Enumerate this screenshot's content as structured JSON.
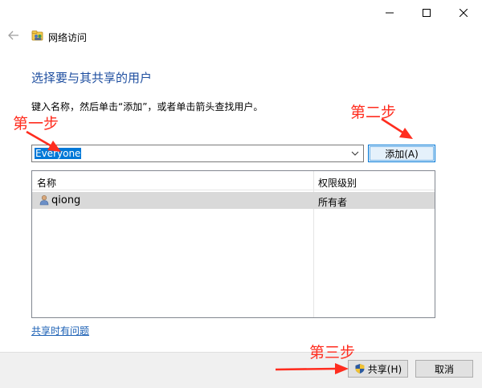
{
  "window": {
    "title": "网络访问",
    "controls": {
      "minimize": "minimize-icon",
      "maximize": "maximize-icon",
      "close": "close-icon"
    }
  },
  "heading": "选择要与其共享的用户",
  "instruction": "键入名称，然后单击“添加”，或者单击箭头查找用户。",
  "combo": {
    "value": "Everyone"
  },
  "add_button": "添加(A)",
  "list": {
    "columns": [
      "名称",
      "权限级别"
    ],
    "rows": [
      {
        "name": "qiong",
        "permission": "所有者",
        "icon": "user-icon"
      }
    ]
  },
  "link": "共享时有问题",
  "footer": {
    "share_button": "共享(H)",
    "cancel_button": "取消"
  },
  "annotations": {
    "step1": "第一步",
    "step2": "第二步",
    "step3": "第三步",
    "color": "#ff2d1f"
  },
  "colors": {
    "heading": "#1f4fa0",
    "selection": "#0078d7",
    "link": "#1a5fb4",
    "row_highlight": "#d9d9d9"
  }
}
